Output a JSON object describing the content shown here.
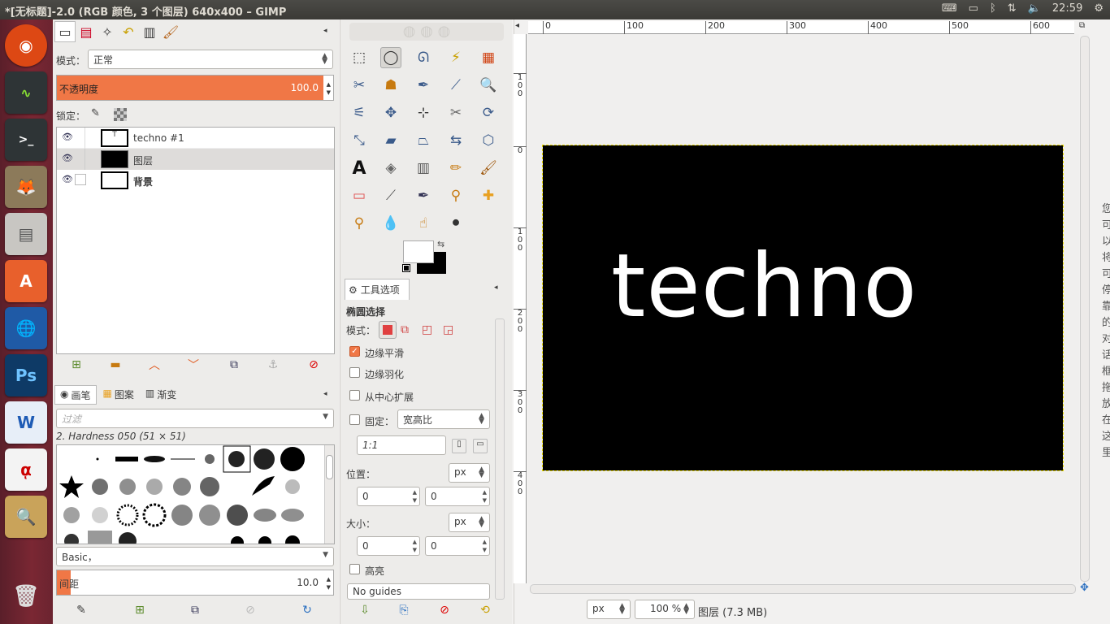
{
  "window": {
    "title": "*[无标题]-2.0 (RGB 颜色, 3 个图层) 640x400 – GIMP"
  },
  "tray": {
    "clock": "22:59"
  },
  "launcher": {
    "items": [
      "ubuntu",
      "system-monitor",
      "terminal",
      "gimp",
      "files",
      "software-center",
      "firefox",
      "ps",
      "wps",
      "acrobat",
      "image-viewer",
      "trash"
    ],
    "labels": {
      "ps": "Ps",
      "wps": "W"
    }
  },
  "layers_panel": {
    "mode_label": "模式：",
    "mode_value": "正常",
    "opacity_label": "不透明度",
    "opacity_value": "100.0",
    "lock_label": "锁定：",
    "layers": [
      {
        "name": "techno #1"
      },
      {
        "name": "图层"
      },
      {
        "name": "背景"
      }
    ]
  },
  "brushes_panel": {
    "tabs": [
      "画笔",
      "图案",
      "渐变"
    ],
    "filter_placeholder": "过滤",
    "brush_name": "2. Hardness 050 (51 × 51)",
    "preset": "Basic，",
    "spacing_label": "间距",
    "spacing_value": "10.0"
  },
  "tool_options": {
    "tab_label": "工具选项",
    "tool_name": "椭圆选择",
    "mode_label": "模式：",
    "antialias_label": "边缘平滑",
    "feather_label": "边缘羽化",
    "expand_label": "从中心扩展",
    "fixed_label": "固定：",
    "fixed_value": "宽高比",
    "ratio_value": "1:1",
    "position_label": "位置：",
    "position_unit": "px",
    "position_x": "0",
    "position_y": "0",
    "size_label": "大小：",
    "size_unit": "px",
    "size_w": "0",
    "size_h": "0",
    "highlight_label": "高亮",
    "guides_value": "No guides"
  },
  "canvas": {
    "text": "techno",
    "ruler_h": [
      "0",
      "100",
      "200",
      "300",
      "400",
      "500",
      "600"
    ],
    "ruler_v": [
      "100",
      "0",
      "100",
      "200",
      "300",
      "400"
    ],
    "right_text": "您可以将可停靠的对话框拖放在这里",
    "status_unit": "px",
    "zoom": "100 %",
    "status_text": "图层 (7.3 MB)"
  },
  "colors": {
    "accent": "#f07746",
    "titlebar": "#3c3b37",
    "launcher": "#6e2430"
  }
}
